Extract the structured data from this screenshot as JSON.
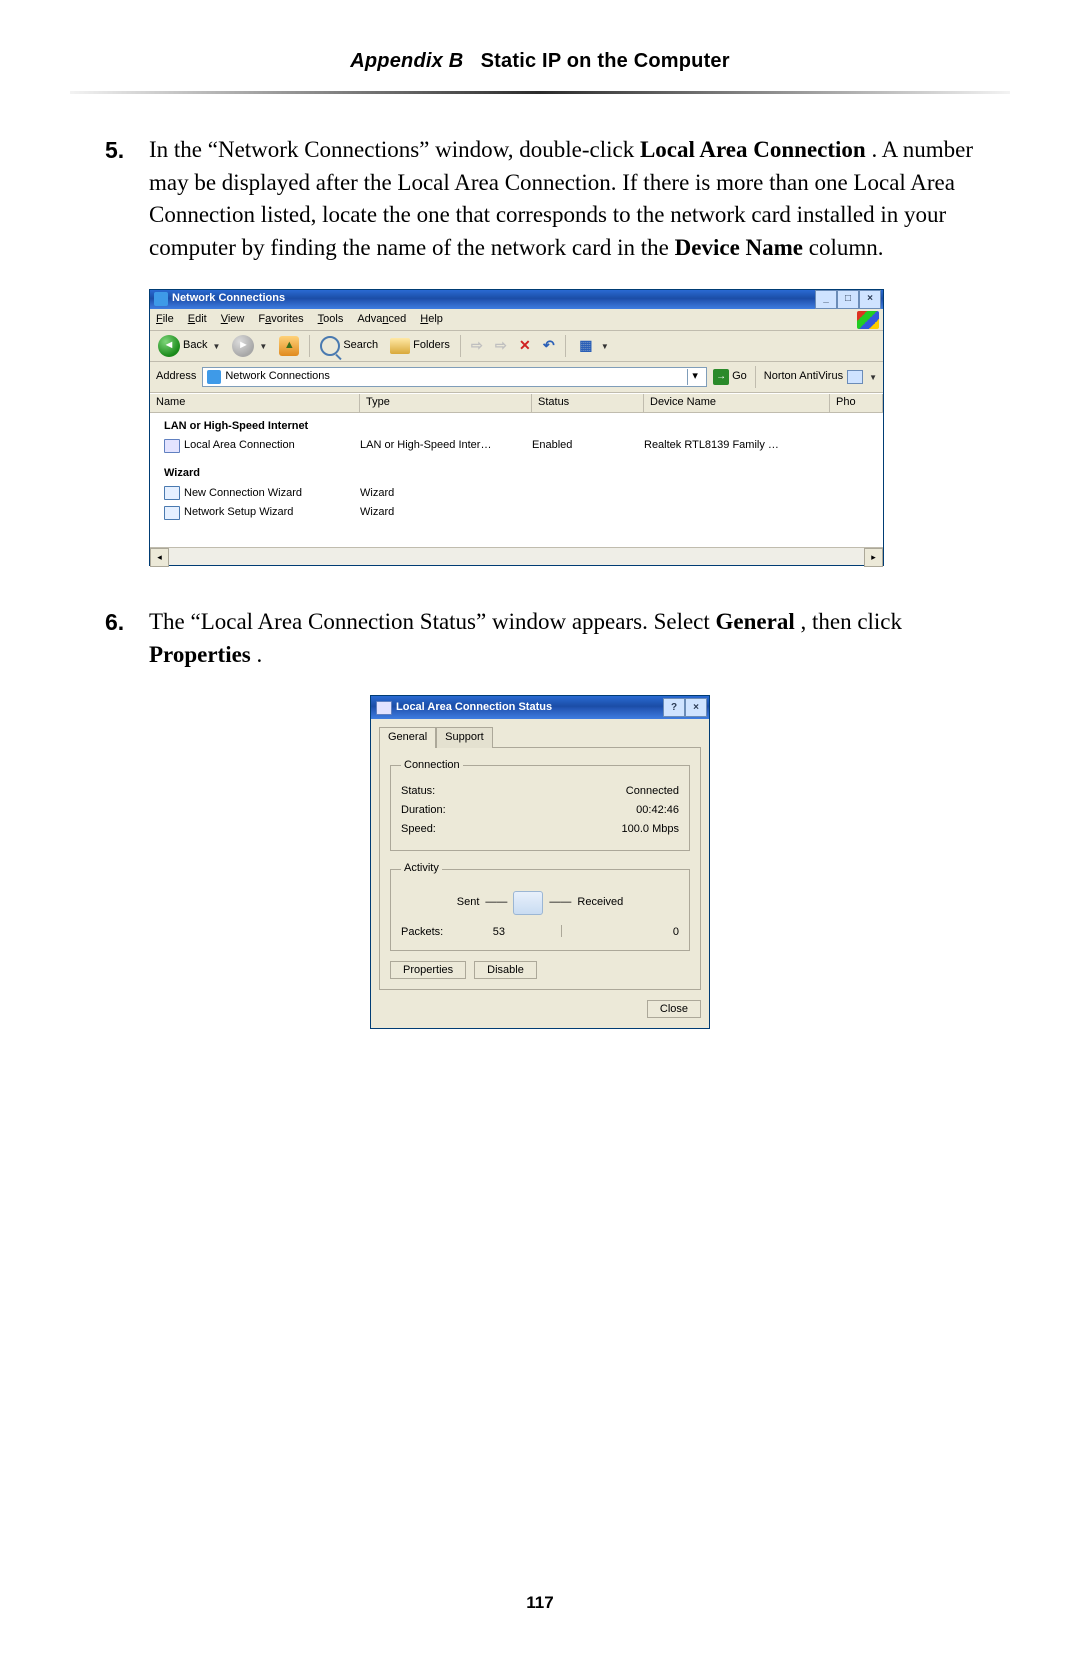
{
  "header": {
    "appendix": "Appendix B",
    "title": "Static IP on the Computer"
  },
  "pagenum": "117",
  "steps": {
    "s5": {
      "num": "5.",
      "pre": "In the “Network Connections” window, double-click ",
      "bold1": "Local Area Connection",
      "post1": ". A number may be displayed after the Local Area Connection. If there is more than one Local Area Connection listed, locate the one that corresponds to the network card installed in your computer by finding the name of the network card in the ",
      "bold2": "Device Name",
      "post2": " column."
    },
    "s6": {
      "num": "6.",
      "pre": "The “Local Area Connection Status” window appears. Select ",
      "bold1": "General",
      "mid": ", then click ",
      "bold2": "Properties",
      "post": "."
    }
  },
  "nc": {
    "title": "Network Connections",
    "menu": [
      "File",
      "Edit",
      "View",
      "Favorites",
      "Tools",
      "Advanced",
      "Help"
    ],
    "back": "Back",
    "search": "Search",
    "folders": "Folders",
    "addrLbl": "Address",
    "addrVal": "Network Connections",
    "go": "Go",
    "nav": "Norton AntiVirus",
    "cols": [
      "Name",
      "Type",
      "Status",
      "Device Name",
      "Pho"
    ],
    "grp1": "LAN or High-Speed Internet",
    "row1": {
      "name": "Local Area Connection",
      "type": "LAN or High-Speed Inter…",
      "status": "Enabled",
      "device": "Realtek RTL8139 Family …"
    },
    "grp2": "Wizard",
    "row2": {
      "name": "New Connection Wizard",
      "type": "Wizard"
    },
    "row3": {
      "name": "Network Setup Wizard",
      "type": "Wizard"
    }
  },
  "lacs": {
    "title": "Local Area Connection Status",
    "tabs": [
      "General",
      "Support"
    ],
    "conn": {
      "legend": "Connection",
      "status_l": "Status:",
      "status_v": "Connected",
      "dur_l": "Duration:",
      "dur_v": "00:42:46",
      "spd_l": "Speed:",
      "spd_v": "100.0 Mbps"
    },
    "act": {
      "legend": "Activity",
      "sent": "Sent",
      "recv": "Received",
      "pk_l": "Packets:",
      "pk_s": "53",
      "pk_r": "0"
    },
    "btns": {
      "prop": "Properties",
      "dis": "Disable",
      "close": "Close"
    }
  }
}
